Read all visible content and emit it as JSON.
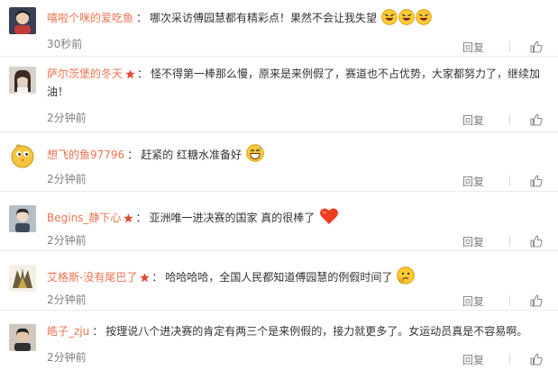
{
  "comments": [
    {
      "username": "嘻啦个咪的爱吃鱼",
      "verified": false,
      "text": "哪次采访傅园慧都有精彩点！果然不会让我失望",
      "emoticons": [
        "laughing-face-icon",
        "laughing-face-icon",
        "laughing-face-icon"
      ],
      "time": "30秒前",
      "reply_label": "回复",
      "avatar_color": "#3b3f55"
    },
    {
      "username": "萨尔茨堡的冬天",
      "verified": true,
      "text": "怪不得第一棒那么慢，原来是来例假了，赛道也不占优势，大家都努力了，继续加油！",
      "emoticons": [],
      "time": "2分钟前",
      "reply_label": "回复",
      "avatar_color": "#c9c2b8"
    },
    {
      "username": "想飞的鱼97796",
      "verified": false,
      "text": "赶紧的 红糖水准备好",
      "emoticons": [
        "grinning-sweat-face-icon"
      ],
      "time": "2分钟前",
      "reply_label": "回复",
      "avatar_color": "#f5c542"
    },
    {
      "username": "Begins_静下心",
      "verified": true,
      "text": "亚洲唯一进决赛的国家 真的很棒了",
      "emoticons": [
        "red-heart-icon"
      ],
      "time": "2分钟前",
      "reply_label": "回复",
      "avatar_color": "#9fa7b0"
    },
    {
      "username": "艾格斯-没有尾巴了",
      "verified": true,
      "text": "哈哈哈哈，全国人民都知道傅园慧的例假时间了",
      "emoticons": [
        "thinking-face-icon"
      ],
      "time": "2分钟前",
      "reply_label": "回复",
      "avatar_color": "#6b5e3a"
    },
    {
      "username": "皓子_zju",
      "verified": false,
      "text": "按理说八个进决赛的肯定有两三个是来例假的，接力就更多了。女运动员真是不容易啊。",
      "emoticons": [],
      "time": "2分钟前",
      "reply_label": "回复",
      "avatar_color": "#c2b8ad"
    }
  ],
  "colors": {
    "username": "#eb7350",
    "text": "#333333",
    "meta": "#808080",
    "separator": "#ebebeb",
    "vip_badge": "#e8452c"
  }
}
